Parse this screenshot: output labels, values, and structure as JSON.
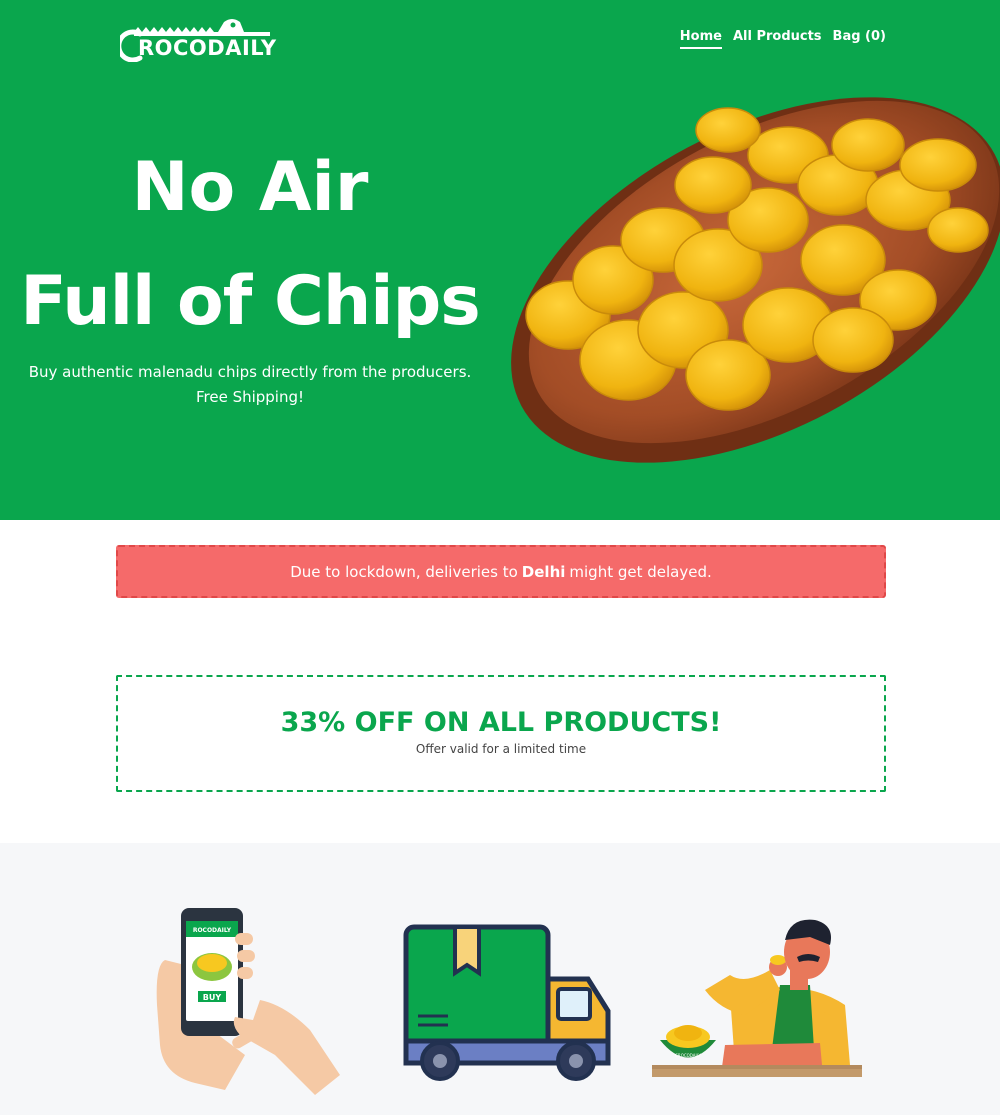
{
  "brand": {
    "name": "ROCODAILY"
  },
  "nav": {
    "items": [
      "Home",
      "All Products",
      "Bag (0)"
    ]
  },
  "hero": {
    "title_line1": "No Air",
    "title_line2": "Full of Chips",
    "subtitle_line1": "Buy authentic malenadu chips directly from the producers.",
    "subtitle_line2": "Free Shipping!"
  },
  "notice": {
    "before": "Due to lockdown, deliveries to",
    "city": "Delhi",
    "after": "might get delayed."
  },
  "offer": {
    "title": "33% OFF ON ALL PRODUCTS!",
    "subtitle": "Offer valid for a limited time"
  },
  "illustrations": {
    "phone_buy_label": "BUY",
    "phone_logo": "ROCODAILY",
    "bowl_logo": "CROCODAILY"
  },
  "colors": {
    "brand_green": "#0aa64d",
    "notice_red": "#f56a6a",
    "steps_bg": "#f6f7f9"
  }
}
